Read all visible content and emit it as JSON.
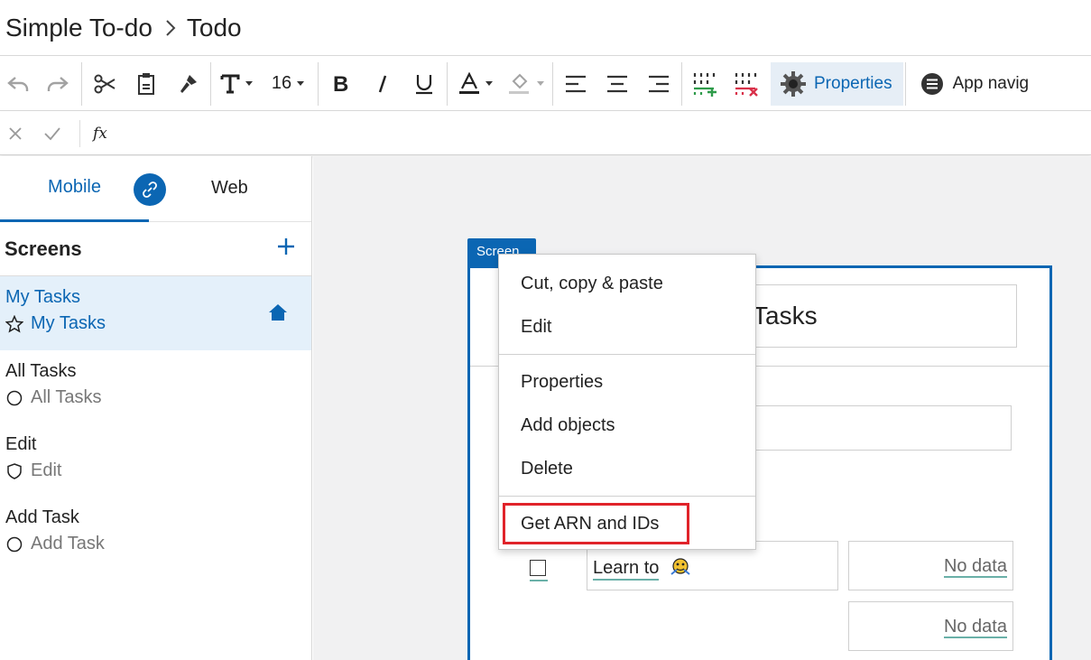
{
  "header": {
    "app_name": "Simple To-do",
    "page_name": "Todo"
  },
  "toolbar": {
    "font_size": "16",
    "properties_label": "Properties",
    "app_nav_label": "App navig",
    "icons": [
      "undo-icon",
      "redo-icon",
      "cut-icon",
      "paste-icon",
      "format-painter-icon",
      "text-icon",
      "bold-icon",
      "italic-icon",
      "underline-icon",
      "font-color-icon",
      "fill-color-icon",
      "align-left-icon",
      "align-center-icon",
      "align-right-icon",
      "add-column-icon",
      "remove-column-icon",
      "gear-icon",
      "menu-icon"
    ]
  },
  "formula_bar": {
    "fx_label": "fx",
    "value": ""
  },
  "left_panel": {
    "tabs": {
      "mobile": "Mobile",
      "web": "Web"
    },
    "screens_title": "Screens",
    "screens": [
      {
        "name": "My Tasks",
        "subtitle": "My Tasks",
        "icon": "star-icon",
        "active": true,
        "home": true
      },
      {
        "name": "All Tasks",
        "subtitle": "All Tasks",
        "icon": "circle-icon",
        "active": false
      },
      {
        "name": "Edit",
        "subtitle": "Edit",
        "icon": "shield-icon",
        "active": false
      },
      {
        "name": "Add Task",
        "subtitle": "Add Task",
        "icon": "circle-icon",
        "active": false
      }
    ]
  },
  "canvas": {
    "screen_tag": "Screen",
    "title_text": "Tasks",
    "row_text": "Learn to",
    "no_data_1": "No data",
    "no_data_2": "No data"
  },
  "context_menu": {
    "items": [
      "Cut, copy & paste",
      "Edit",
      "Properties",
      "Add objects",
      "Delete",
      "Get ARN and IDs"
    ],
    "highlighted": "Get ARN and IDs"
  },
  "colors": {
    "accent": "#0b66b3",
    "highlight_border": "#e0232a",
    "active_bg": "#e4f0fa"
  }
}
